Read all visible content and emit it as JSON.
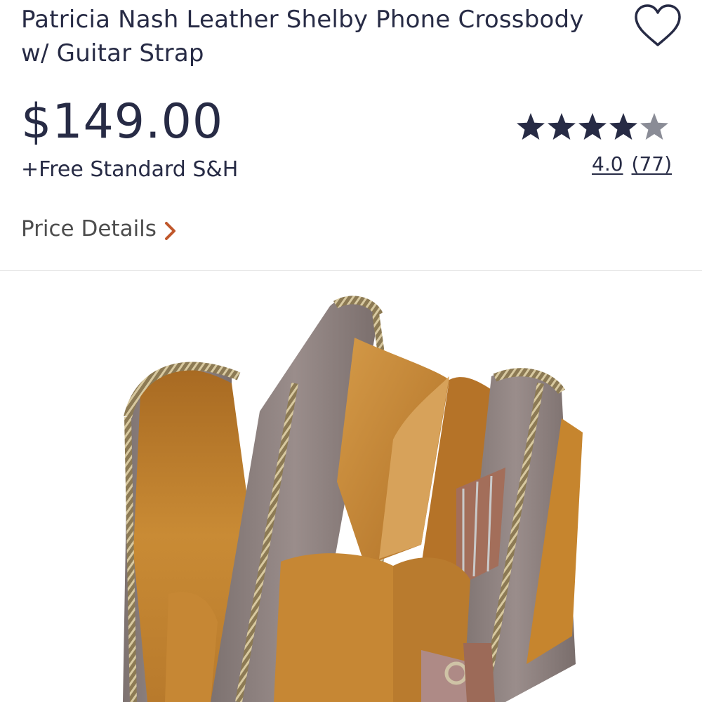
{
  "product": {
    "title": "Patricia Nash Leather Shelby Phone Crossbody w/ Guitar Strap",
    "price": "$149.00",
    "shipping": "+Free Standard S&H",
    "rating_value": "4.0",
    "review_count": "(77)",
    "rating_out_of_5": 4.0,
    "price_details_label": "Price Details"
  },
  "icons": {
    "favorite": "heart-outline-icon",
    "rating": "star-icon",
    "price_details": "chevron-right-icon"
  },
  "colors": {
    "text": "#272b45",
    "star_filled": "#272b45",
    "star_empty": "#8a8c96",
    "chevron": "#c0582c",
    "muted_text": "#4d4d4d",
    "bag_leather": "#8b7f7e",
    "bag_lining": "#c6852e"
  }
}
